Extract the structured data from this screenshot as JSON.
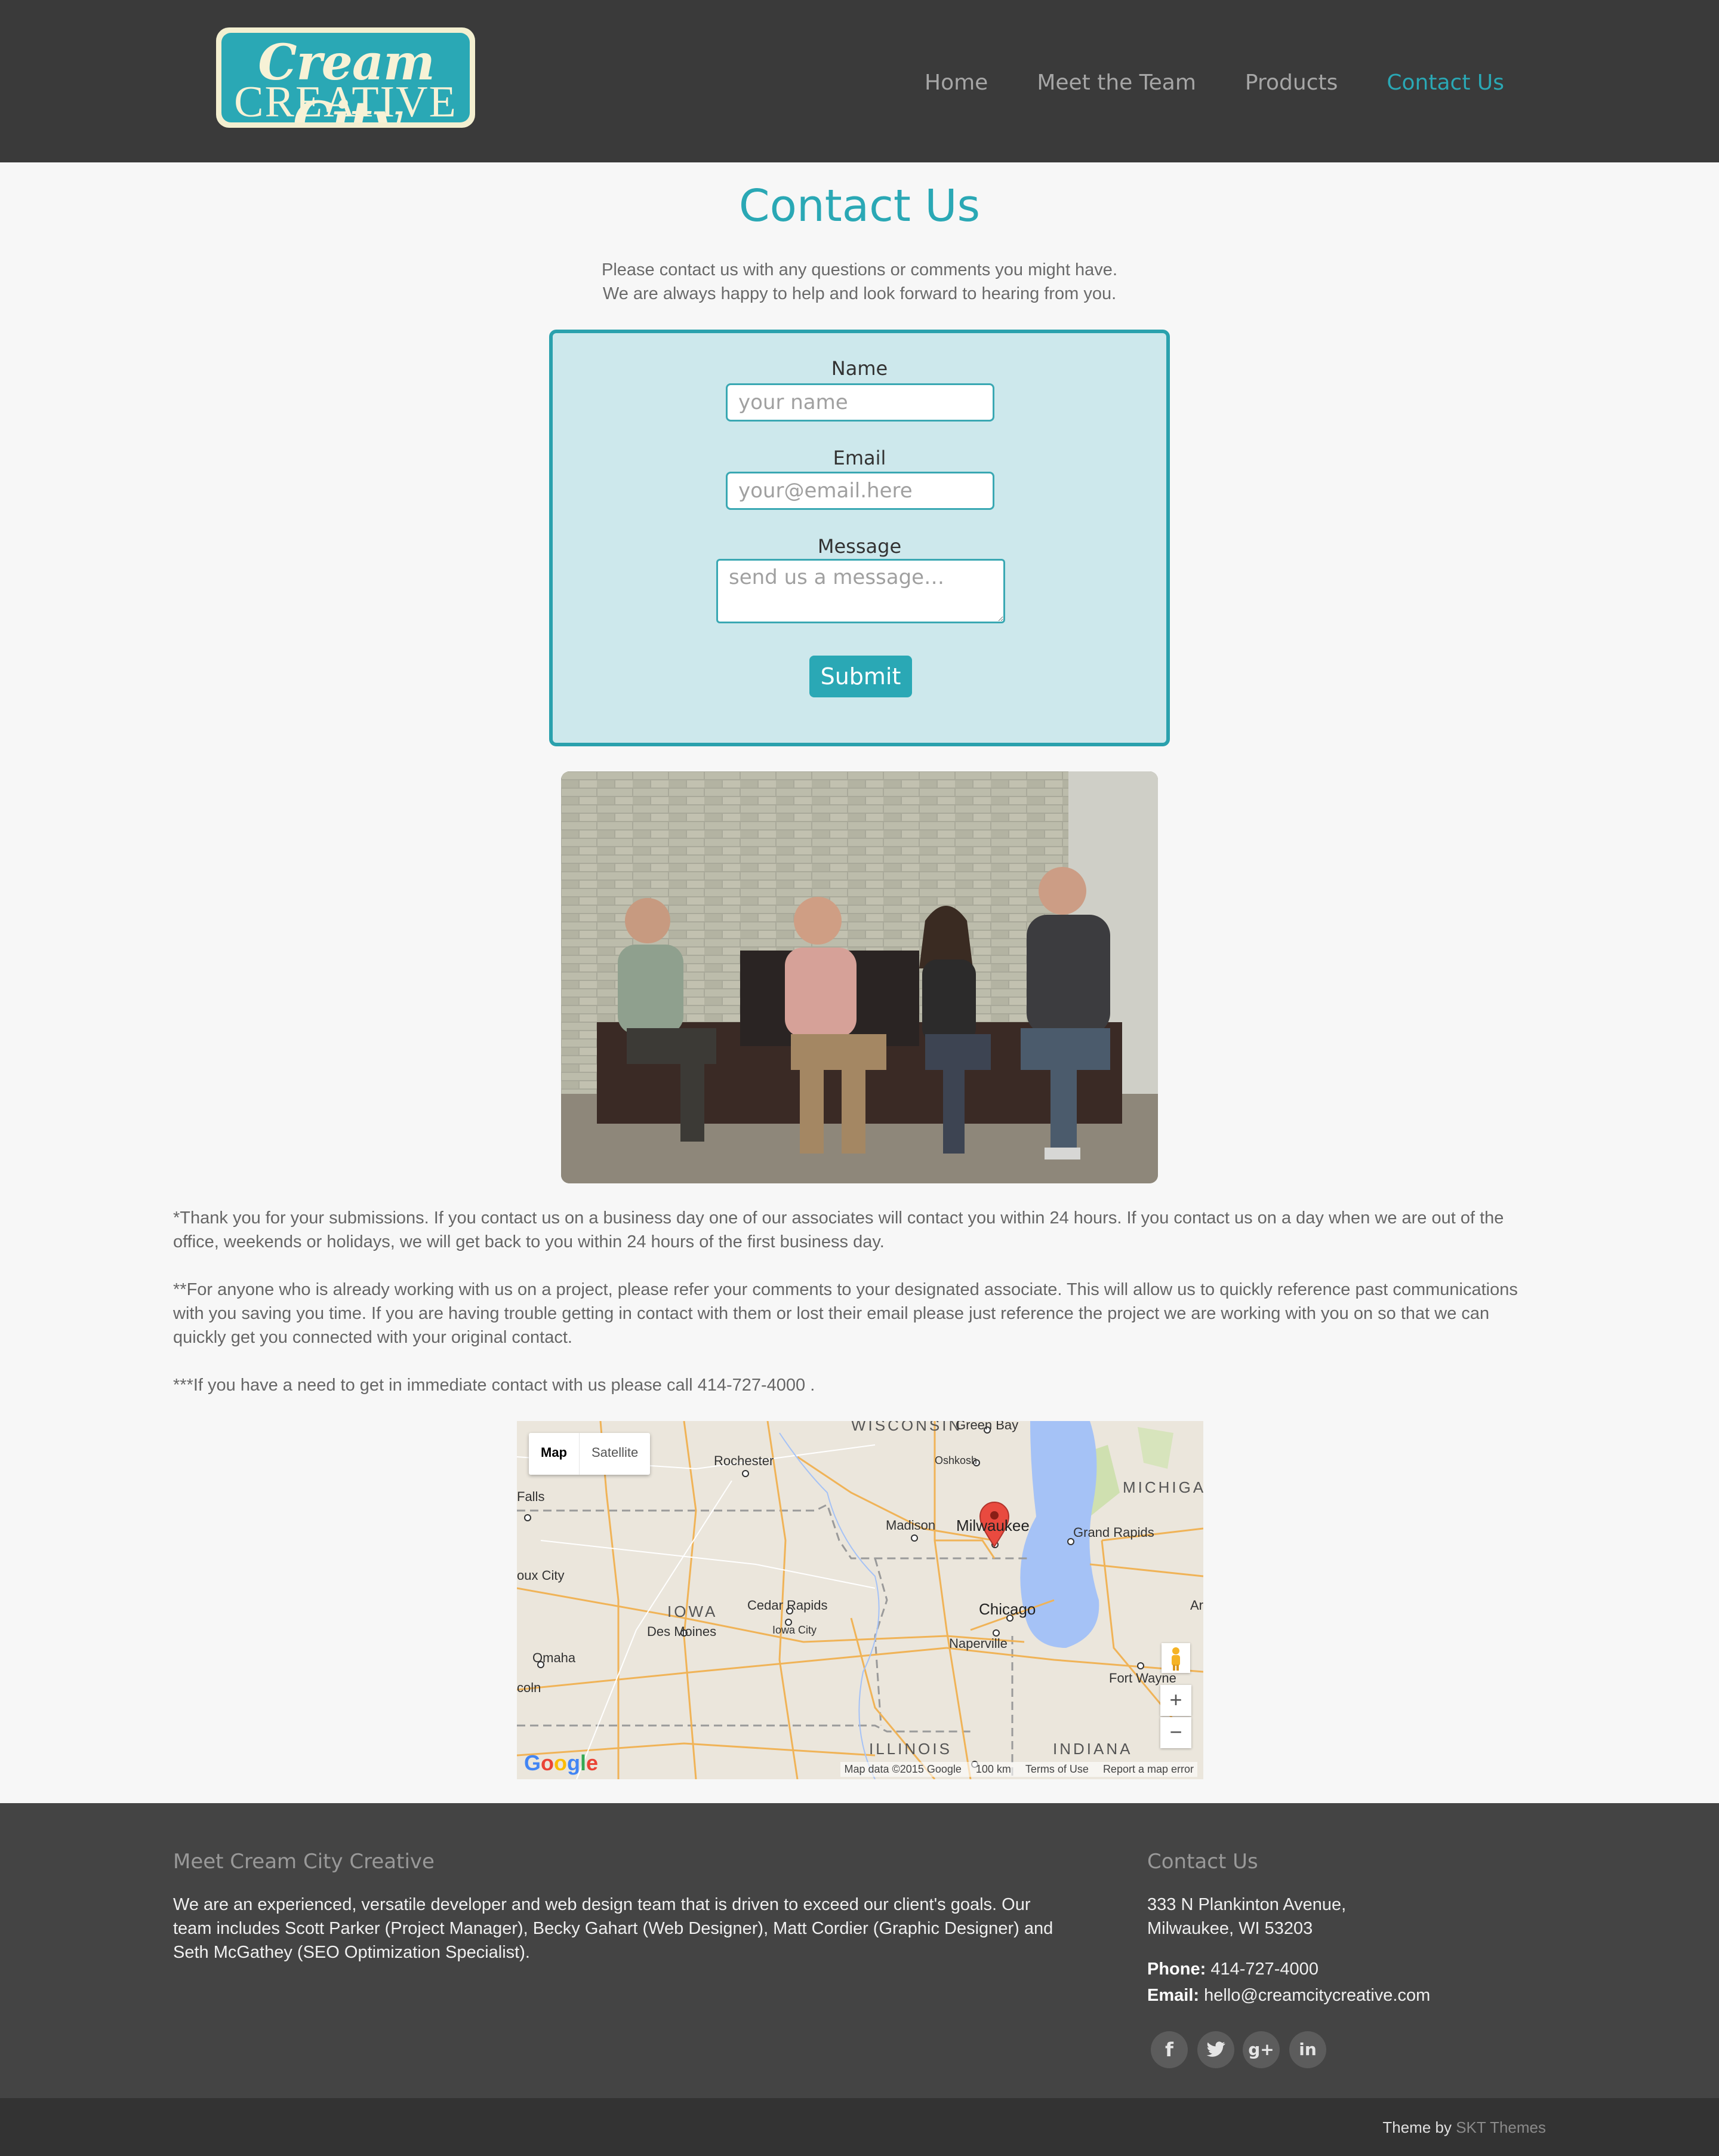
{
  "header": {
    "logo_line1": "Cream City",
    "logo_line2": "CREATIVE",
    "nav": [
      "Home",
      "Meet the Team",
      "Products",
      "Contact Us"
    ],
    "active_nav": "Contact Us"
  },
  "main": {
    "title": "Contact Us",
    "intro_line1": "Please contact us with any questions or comments you might have.",
    "intro_line2": "We are always happy to help and look forward to hearing from you.",
    "form": {
      "name_label": "Name",
      "name_placeholder": "your name",
      "email_label": "Email",
      "email_placeholder": "your@email.here",
      "message_label": "Message",
      "message_placeholder": "send us a message…",
      "submit_label": "Submit"
    },
    "notes": [
      "*Thank you for your submissions. If you contact us on a business day one of our associates will contact you within 24 hours. If you contact us on a day when we are out of the office, weekends or holidays, we will get back to you within 24 hours of the first business day.",
      "**For anyone who is already working with us on a project, please refer your comments to your designated associate. This will allow us to quickly reference past communications with you saving you time. If you are having trouble getting in contact with them or lost their email please just reference the project we are working with you on so that we can quickly get you connected with your original contact.",
      "***If you have a need to get in immediate contact with us please call 414-727-4000 ."
    ],
    "map": {
      "map_tab": "Map",
      "satellite_tab": "Satellite",
      "cities": {
        "green_bay": "Green Bay",
        "oshkosh": "Oshkosh",
        "rochester": "Rochester",
        "falls": "Falls",
        "madison": "Madison",
        "milwaukee": "Milwaukee",
        "grand_rapids": "Grand Rapids",
        "sioux_city": "oux City",
        "cedar_rapids": "Cedar Rapids",
        "des_moines": "Des Moines",
        "iowa_city": "Iowa City",
        "chicago": "Chicago",
        "naperville": "Naperville",
        "omaha": "Omaha",
        "lincoln": "coln",
        "fort_wayne": "Fort Wayne",
        "ar": "Ar"
      },
      "states": {
        "wisconsin": "WISCONSIN",
        "iowa": "IOWA",
        "illinois": "ILLINOIS",
        "indiana": "INDIANA",
        "michigan": "MICHIGA"
      },
      "zoom_in": "+",
      "zoom_out": "−",
      "google": "Google",
      "map_data": "Map data ©2015 Google",
      "scale": "100 km",
      "terms": "Terms of Use",
      "report": "Report a map error"
    }
  },
  "footer": {
    "about_heading": "Meet Cream City Creative",
    "about_text": "We are an experienced, versatile developer and web design team that is driven to exceed our client's goals. Our team includes Scott Parker (Project Manager), Becky Gahart (Web Designer), Matt Cordier (Graphic Designer) and Seth McGathey (SEO Optimization Specialist).",
    "contact_heading": "Contact Us",
    "address": "333 N Plankinton Avenue, Milwaukee, WI 53203",
    "phone_label": "Phone:",
    "phone": "414-727-4000",
    "email_label": "Email:",
    "email": "hello@creamcitycreative.com",
    "social": [
      "f",
      "t",
      "g+",
      "in"
    ]
  },
  "bottom": {
    "theme_by": "Theme by",
    "theme_link": "SKT Themes"
  },
  "colors": {
    "accent": "#2aa8b5",
    "header_bg": "#3a3a3a",
    "footer_bg": "#444444",
    "form_bg": "#cde8ec"
  }
}
